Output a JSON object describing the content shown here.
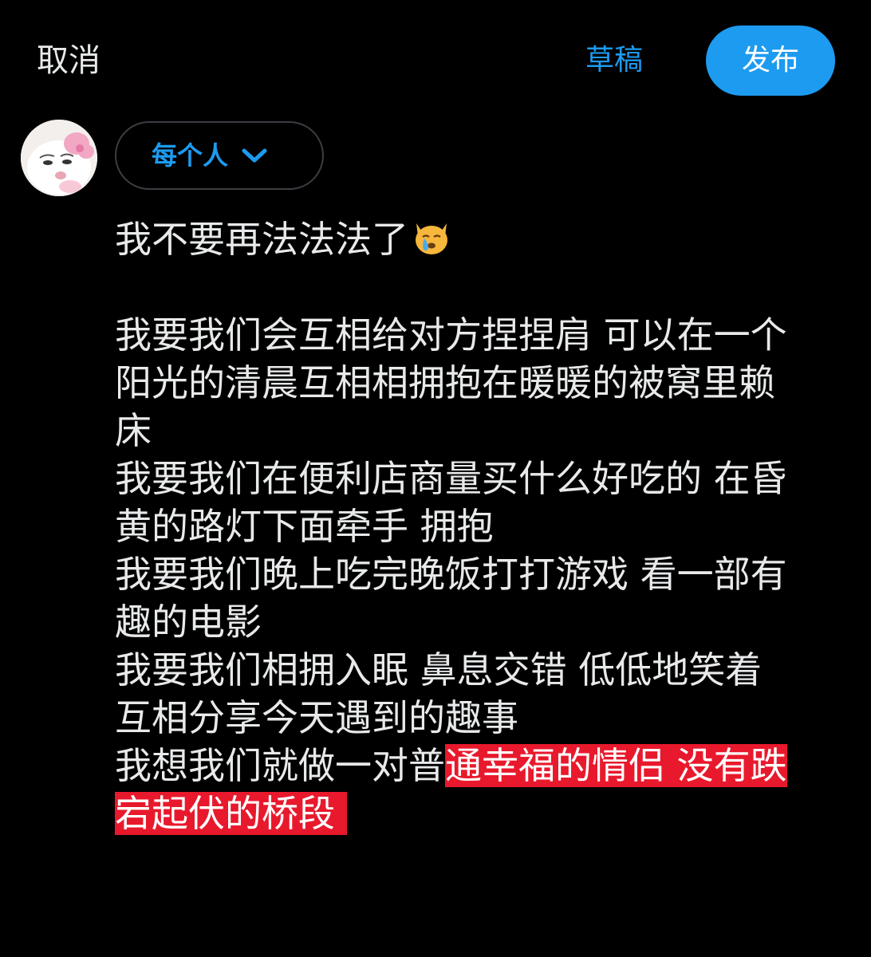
{
  "header": {
    "cancel_label": "取消",
    "drafts_label": "草稿",
    "post_label": "发布"
  },
  "audience": {
    "label": "每个人"
  },
  "colors": {
    "accent": "#1d9bf0",
    "highlight": "#e8192c",
    "background": "#000000",
    "text": "#e7e9ea"
  },
  "composer": {
    "title_text": "我不要再法法法了",
    "title_emoji": "crying-cat-face",
    "lines": [
      "我要我们会互相给对方捏捏肩 可以在一个",
      "阳光的清晨互相相拥抱在暖暖的被窝里赖",
      "床",
      "我要我们在便利店商量买什么好吃的 在昏",
      "黄的路灯下面牵手 拥抱",
      "我要我们晚上吃完晚饭打打游戏 看一部有",
      "趣的电影",
      "我要我们相拥入眠 鼻息交错 低低地笑着",
      "互相分享今天遇到的趣事"
    ],
    "last_line_plain": "我想我们就做一对普",
    "last_line_highlighted": "通幸福的情侣 没有跌",
    "final_line_highlighted": "宕起伏的桥段"
  }
}
